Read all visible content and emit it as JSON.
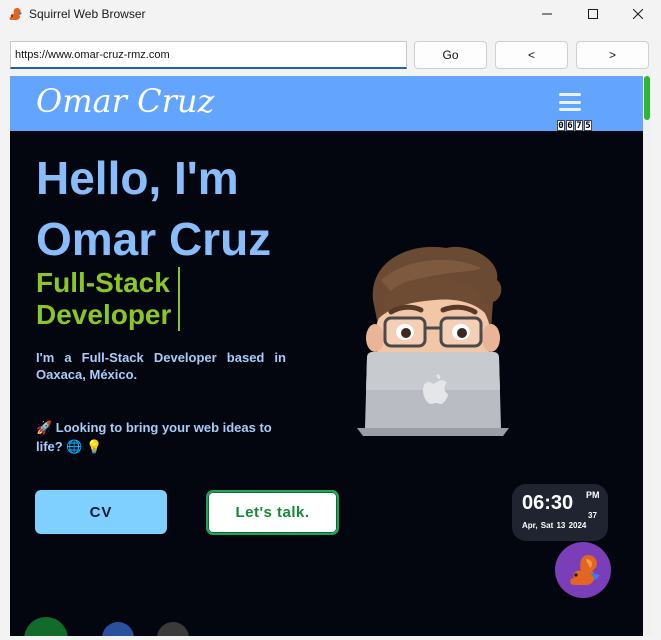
{
  "window": {
    "title": "Squirrel Web Browser",
    "minimize_glyph": "—",
    "maximize_glyph": "☐",
    "close_glyph": "✕"
  },
  "toolbar": {
    "url": "https://www.omar-cruz-rmz.com",
    "go_label": "Go",
    "back_label": "<",
    "forward_label": ">"
  },
  "site": {
    "logo": "Omar Cruz",
    "visit_counter": [
      "0",
      "6",
      "7",
      "5"
    ],
    "hero": {
      "title": "Hello, I'm Omar Cruz",
      "role": "Full-Stack Developer",
      "description": "I'm a Full-Stack Developer based in Oaxaca, México.",
      "pitch": "🚀 Looking to bring your web ideas to life? 🌐 💡",
      "cv_label": "CV",
      "talk_label": "Let's talk."
    }
  },
  "clock": {
    "time": "06:30",
    "ampm": "PM",
    "seconds": "37",
    "date": "Apr, Sat 13 2024"
  },
  "colors": {
    "nav_bg": "#63a4ff",
    "page_bg": "#03050f",
    "title_blue": "#89bdf9",
    "role_green": "#8ac628",
    "cv_bg": "#80d0ff",
    "talk_border": "#22a35a",
    "fab_bg": "#7a3fb8"
  }
}
